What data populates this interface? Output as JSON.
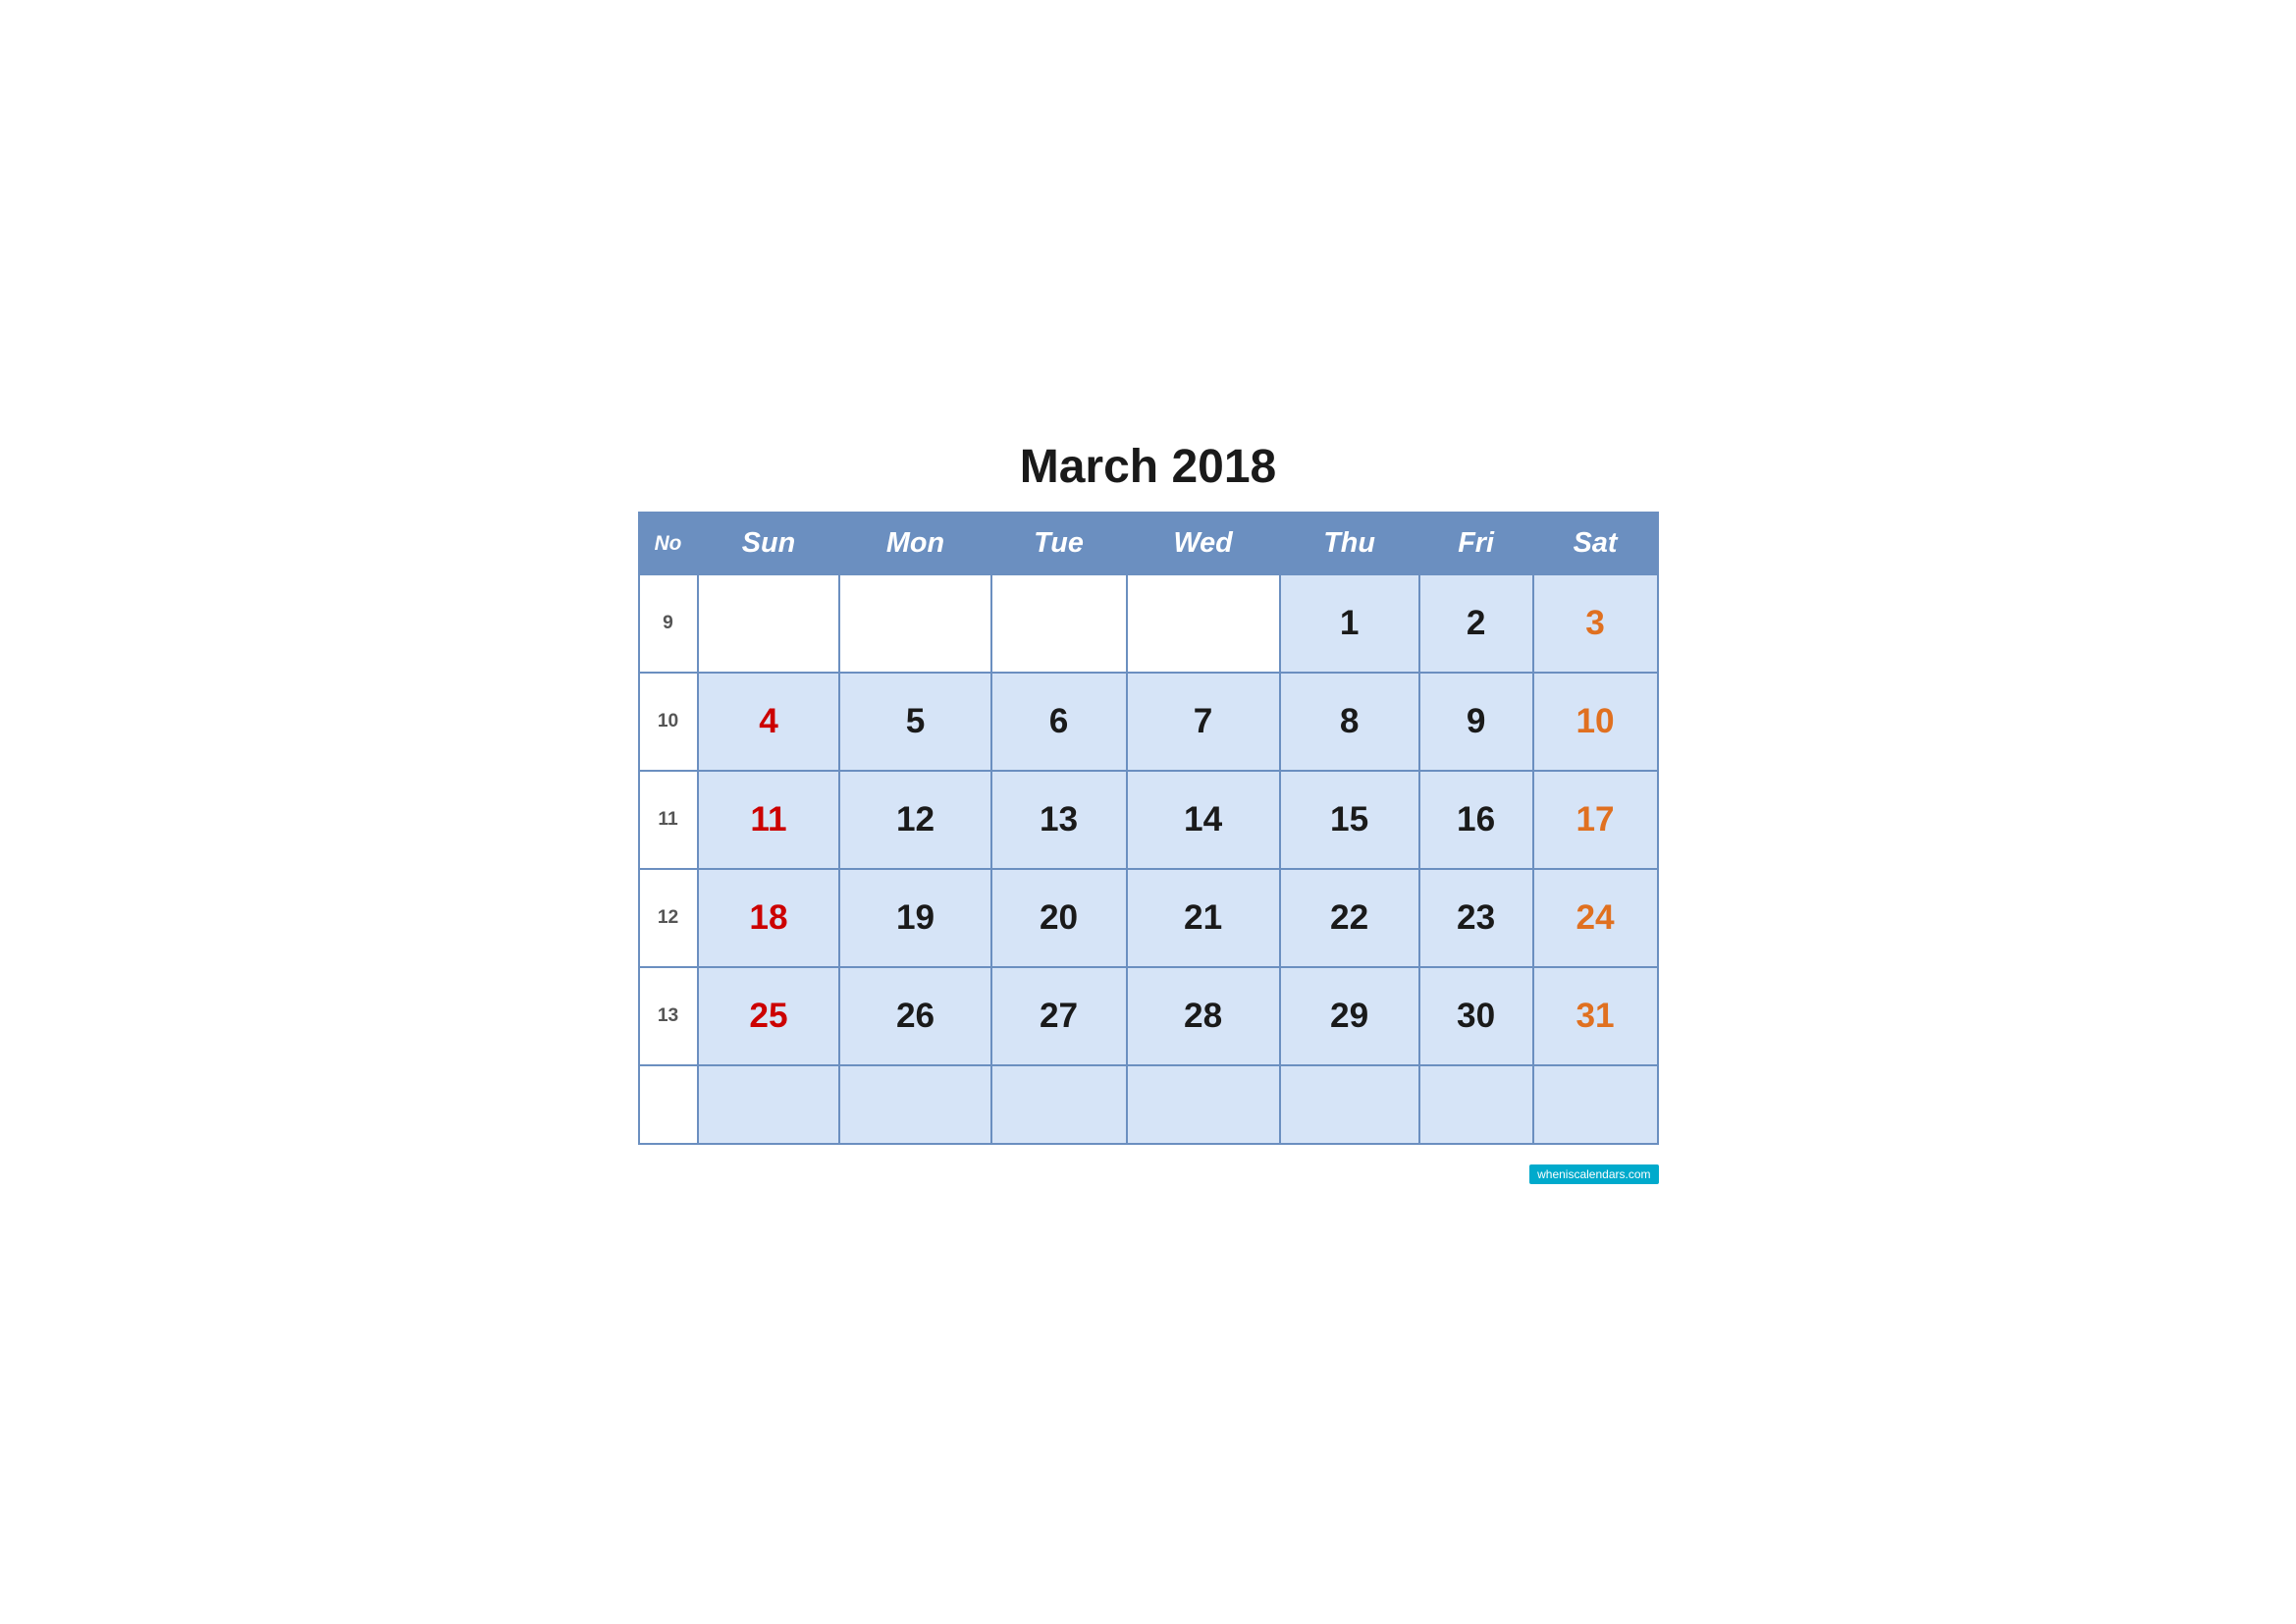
{
  "title": "March 2018",
  "header": {
    "no": "No",
    "sun": "Sun",
    "mon": "Mon",
    "tue": "Tue",
    "wed": "Wed",
    "thu": "Thu",
    "fri": "Fri",
    "sat": "Sat"
  },
  "weeks": [
    {
      "week_num": "9",
      "days": [
        {
          "day": "",
          "type": "empty"
        },
        {
          "day": "",
          "type": "empty"
        },
        {
          "day": "",
          "type": "empty"
        },
        {
          "day": "",
          "type": "empty"
        },
        {
          "day": "1",
          "type": "normal"
        },
        {
          "day": "2",
          "type": "normal"
        },
        {
          "day": "3",
          "type": "sat"
        }
      ]
    },
    {
      "week_num": "10",
      "days": [
        {
          "day": "4",
          "type": "sun"
        },
        {
          "day": "5",
          "type": "normal"
        },
        {
          "day": "6",
          "type": "normal"
        },
        {
          "day": "7",
          "type": "normal"
        },
        {
          "day": "8",
          "type": "normal"
        },
        {
          "day": "9",
          "type": "normal"
        },
        {
          "day": "10",
          "type": "sat"
        }
      ]
    },
    {
      "week_num": "11",
      "days": [
        {
          "day": "11",
          "type": "sun"
        },
        {
          "day": "12",
          "type": "normal"
        },
        {
          "day": "13",
          "type": "normal"
        },
        {
          "day": "14",
          "type": "normal"
        },
        {
          "day": "15",
          "type": "normal"
        },
        {
          "day": "16",
          "type": "normal"
        },
        {
          "day": "17",
          "type": "sat"
        }
      ]
    },
    {
      "week_num": "12",
      "days": [
        {
          "day": "18",
          "type": "sun"
        },
        {
          "day": "19",
          "type": "normal"
        },
        {
          "day": "20",
          "type": "normal"
        },
        {
          "day": "21",
          "type": "normal"
        },
        {
          "day": "22",
          "type": "normal"
        },
        {
          "day": "23",
          "type": "normal"
        },
        {
          "day": "24",
          "type": "sat"
        }
      ]
    },
    {
      "week_num": "13",
      "days": [
        {
          "day": "25",
          "type": "sun"
        },
        {
          "day": "26",
          "type": "normal"
        },
        {
          "day": "27",
          "type": "normal"
        },
        {
          "day": "28",
          "type": "normal"
        },
        {
          "day": "29",
          "type": "normal"
        },
        {
          "day": "30",
          "type": "normal"
        },
        {
          "day": "31",
          "type": "sat"
        }
      ]
    }
  ],
  "watermark": {
    "prefix": "whenis",
    "highlight": "is",
    "suffix": "calendars.com"
  }
}
